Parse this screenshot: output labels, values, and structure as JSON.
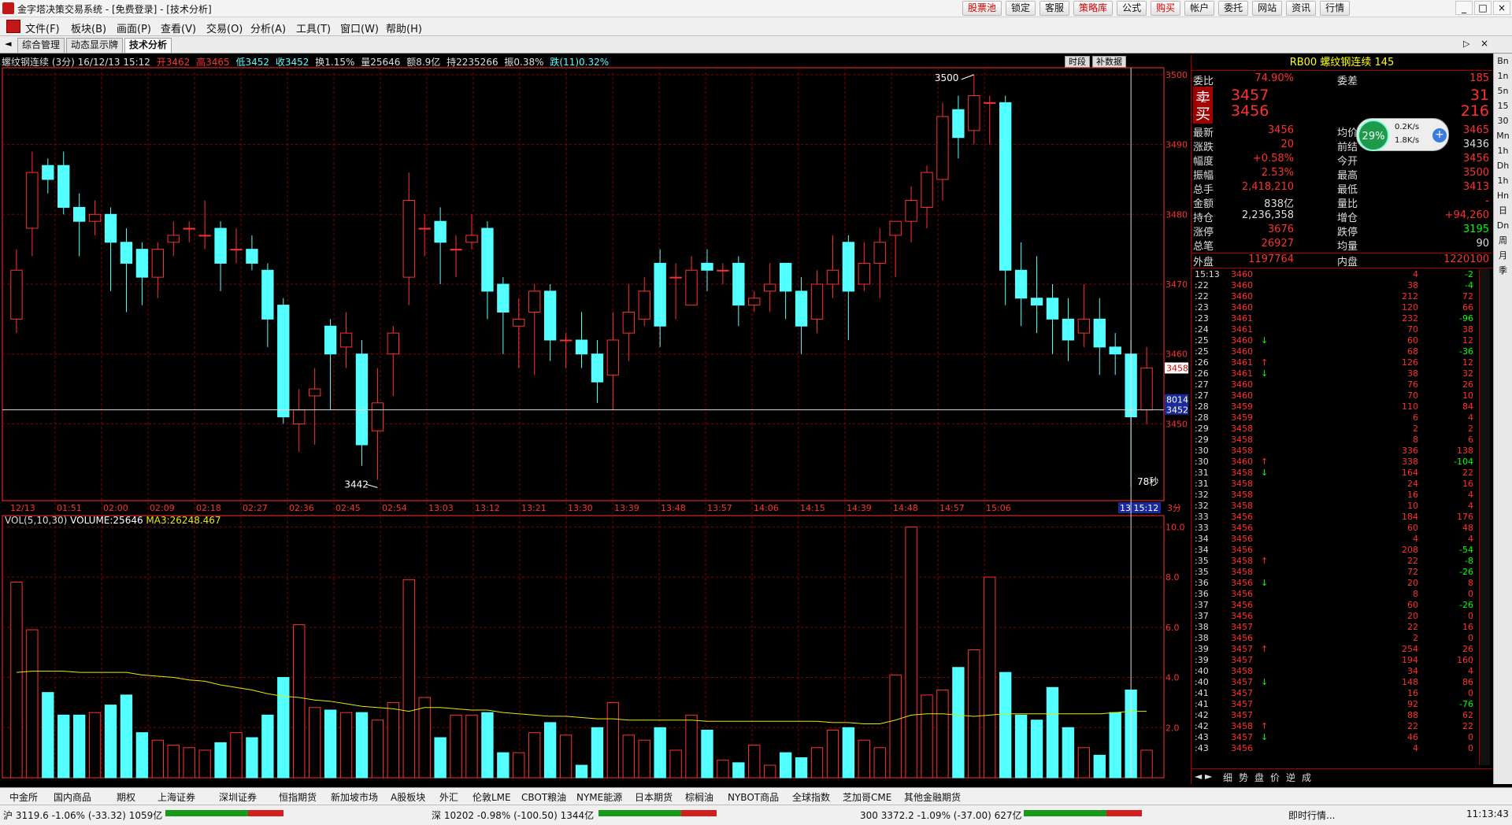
{
  "window": {
    "title": "金字塔决策交易系统 - [免费登录] - [技术分析]",
    "top_buttons": [
      "股票池",
      "锁定",
      "客服",
      "策略库",
      "公式",
      "购买",
      "帐户",
      "委托",
      "网站",
      "资讯",
      "行情"
    ],
    "controls": [
      "_",
      "□",
      "×"
    ]
  },
  "menu": [
    "文件(F)",
    "板块(B)",
    "画面(P)",
    "查看(V)",
    "交易(O)",
    "分析(A)",
    "工具(T)",
    "窗口(W)",
    "帮助(H)"
  ],
  "tabs": [
    "综合管理",
    "动态显示牌",
    "技术分析"
  ],
  "chart_header": {
    "name": "螺纹钢连续 (3分) 16/12/13 15:12",
    "open": "开3462",
    "high": "高3465",
    "low": "低3452",
    "close": "收3452",
    "turnover": "换1.15%",
    "volume": "量25646",
    "amount": "额8.9亿",
    "holding": "持2235266",
    "amplitude": "振0.38%",
    "change": "跌(11)0.32%"
  },
  "chart_buttons": [
    "时段",
    "补数据"
  ],
  "vol_header": {
    "label": "VOL(5,10,30)",
    "volume": "VOLUME:25646",
    "ma3": "MA3:26248.467"
  },
  "colors": {
    "up": "#ff3030",
    "down": "#54ffff",
    "ma": "#e8e800",
    "grid": "#880000",
    "axis": "#ff3030"
  },
  "chart_data": {
    "type": "candlestick",
    "title": "螺纹钢连续 (3分)",
    "time_labels": [
      "12/13",
      "01:51",
      "02:00",
      "02:09",
      "02:18",
      "02:27",
      "02:36",
      "02:45",
      "02:54",
      "13:03",
      "13:12",
      "13:21",
      "13:30",
      "13:39",
      "13:48",
      "13:57",
      "14:06",
      "14:15",
      "14:39",
      "14:48",
      "14:57",
      "15:06",
      "13 15:12"
    ],
    "price_ticks": [
      "3500",
      "3490",
      "3480",
      "3470",
      "3460",
      "3450"
    ],
    "price_range": [
      3439,
      3501
    ],
    "high_label": "3500",
    "low_label": "3442",
    "current_price_label": "3458",
    "current_price_label2": "3452",
    "current_tag": "8014",
    "countdown": "78秒",
    "period_label": "3分",
    "candles": [
      [
        3465,
        3472,
        3463,
        3475
      ],
      [
        3478,
        3486,
        3474,
        3489
      ],
      [
        3487,
        3485,
        3483,
        3488
      ],
      [
        3487,
        3481,
        3480,
        3489
      ],
      [
        3481,
        3479,
        3474,
        3483
      ],
      [
        3479,
        3480,
        3477,
        3482
      ],
      [
        3480,
        3476,
        3469,
        3481
      ],
      [
        3476,
        3473,
        3466,
        3478
      ],
      [
        3475,
        3471,
        3467,
        3476
      ],
      [
        3471,
        3475,
        3468,
        3476
      ],
      [
        3476,
        3477,
        3474,
        3479
      ],
      [
        3478,
        3478,
        3476,
        3479
      ],
      [
        3477,
        3477,
        3475,
        3482
      ],
      [
        3478,
        3473,
        3469,
        3479
      ],
      [
        3475,
        3475,
        3473,
        3478
      ],
      [
        3475,
        3473,
        3472,
        3477
      ],
      [
        3472,
        3465,
        3461,
        3473
      ],
      [
        3467,
        3451,
        3450,
        3468
      ],
      [
        3450,
        3452,
        3446,
        3455
      ],
      [
        3454,
        3455,
        3447,
        3458
      ],
      [
        3464,
        3460,
        3452,
        3465
      ],
      [
        3461,
        3463,
        3458,
        3466
      ],
      [
        3460,
        3447,
        3444,
        3462
      ],
      [
        3449,
        3453,
        3442,
        3458
      ],
      [
        3460,
        3463,
        3454,
        3464
      ],
      [
        3471,
        3482,
        3467,
        3486
      ],
      [
        3478,
        3478,
        3474,
        3480
      ],
      [
        3479,
        3476,
        3470,
        3481
      ],
      [
        3475,
        3475,
        3471,
        3477
      ],
      [
        3476,
        3477,
        3475,
        3480
      ],
      [
        3478,
        3469,
        3465,
        3479
      ],
      [
        3470,
        3466,
        3460,
        3471
      ],
      [
        3464,
        3465,
        3458,
        3468
      ],
      [
        3466,
        3469,
        3457,
        3470
      ],
      [
        3469,
        3462,
        3459,
        3470
      ],
      [
        3462,
        3462,
        3458,
        3463
      ],
      [
        3462,
        3460,
        3458,
        3466
      ],
      [
        3460,
        3456,
        3453,
        3462
      ],
      [
        3457,
        3462,
        3452,
        3466
      ],
      [
        3463,
        3466,
        3459,
        3470
      ],
      [
        3465,
        3469,
        3464,
        3471
      ],
      [
        3473,
        3464,
        3461,
        3475
      ],
      [
        3471,
        3471,
        3465,
        3473
      ],
      [
        3467,
        3472,
        3467,
        3474
      ],
      [
        3473,
        3472,
        3469,
        3475
      ],
      [
        3472,
        3472,
        3470,
        3473
      ],
      [
        3473,
        3467,
        3464,
        3474
      ],
      [
        3467,
        3468,
        3466,
        3469
      ],
      [
        3469,
        3470,
        3466,
        3473
      ],
      [
        3473,
        3469,
        3465,
        3473
      ],
      [
        3469,
        3464,
        3460,
        3471
      ],
      [
        3465,
        3470,
        3463,
        3472
      ],
      [
        3470,
        3472,
        3468,
        3477
      ],
      [
        3476,
        3469,
        3462,
        3477
      ],
      [
        3470,
        3473,
        3469,
        3476
      ],
      [
        3473,
        3476,
        3468,
        3478
      ],
      [
        3477,
        3479,
        3471,
        3479
      ],
      [
        3479,
        3482,
        3476,
        3484
      ],
      [
        3481,
        3486,
        3478,
        3487
      ],
      [
        3485,
        3494,
        3482,
        3496
      ],
      [
        3495,
        3491,
        3488,
        3497
      ],
      [
        3492,
        3497,
        3490,
        3500
      ],
      [
        3496,
        3496,
        3490,
        3497
      ],
      [
        3496,
        3472,
        3467,
        3497
      ],
      [
        3472,
        3468,
        3464,
        3476
      ],
      [
        3468,
        3467,
        3463,
        3474
      ],
      [
        3468,
        3465,
        3460,
        3470
      ],
      [
        3465,
        3462,
        3459,
        3468
      ],
      [
        3463,
        3465,
        3461,
        3470
      ],
      [
        3465,
        3461,
        3457,
        3468
      ],
      [
        3461,
        3460,
        3457,
        3463
      ],
      [
        3460,
        3451,
        3441,
        3462
      ],
      [
        3452,
        3458,
        3450,
        3461
      ]
    ],
    "volumes": [
      7.8,
      5.9,
      3.4,
      2.5,
      2.5,
      2.6,
      2.9,
      3.3,
      1.8,
      1.5,
      1.3,
      1.2,
      1.1,
      1.4,
      1.8,
      1.6,
      2.5,
      4.0,
      6.1,
      2.8,
      2.7,
      2.6,
      2.6,
      2.3,
      3.0,
      7.9,
      3.2,
      1.6,
      2.5,
      2.5,
      2.6,
      1.0,
      1.0,
      1.8,
      2.2,
      1.7,
      0.5,
      2.0,
      3.0,
      1.7,
      1.5,
      2.0,
      1.1,
      2.5,
      1.9,
      0.7,
      0.6,
      1.3,
      0.5,
      1.0,
      0.8,
      1.2,
      1.9,
      2.0,
      1.5,
      1.2,
      4.1,
      10.0,
      3.3,
      3.5,
      4.4,
      5.1,
      8.0,
      4.2,
      2.5,
      2.3,
      3.6,
      2.0,
      1.2,
      0.9,
      2.6,
      3.5,
      1.1
    ],
    "ma_values": [
      4.2,
      4.25,
      4.25,
      4.25,
      4.2,
      4.2,
      4.2,
      4.2,
      4.1,
      4.05,
      4.0,
      3.9,
      3.85,
      3.7,
      3.6,
      3.5,
      3.35,
      3.25,
      3.2,
      3.1,
      3.05,
      2.95,
      2.85,
      2.8,
      2.75,
      2.65,
      2.8,
      2.8,
      2.75,
      2.7,
      2.7,
      2.6,
      2.55,
      2.5,
      2.45,
      2.45,
      2.4,
      2.35,
      2.35,
      2.3,
      2.3,
      2.3,
      2.3,
      2.3,
      2.25,
      2.25,
      2.25,
      2.25,
      2.25,
      2.25,
      2.25,
      2.25,
      2.2,
      2.2,
      2.15,
      2.15,
      2.3,
      2.5,
      2.55,
      2.55,
      2.5,
      2.45,
      2.5,
      2.55,
      2.55,
      2.55,
      2.55,
      2.55,
      2.55,
      2.55,
      2.6,
      2.65,
      2.65
    ],
    "vol_ticks": [
      "10.0",
      "8.0",
      "6.0",
      "4.0",
      "2.0"
    ],
    "vol_range": [
      0,
      10.2
    ],
    "legend": "VOL(5,10,30)"
  },
  "quote_panel": {
    "header": "RB00  螺纹钢连续  145",
    "rows": [
      {
        "l": "委比",
        "v1": "74.90%",
        "l2": "委差",
        "v2": "185"
      },
      {
        "l": "卖",
        "v1": "3457",
        "l2": "",
        "v2": "31"
      },
      {
        "l": "买",
        "v1": "3456",
        "l2": "",
        "v2": "216"
      },
      {
        "l": "最新",
        "v1": "3456",
        "l2": "均价",
        "v2": "3465"
      },
      {
        "l": "涨跌",
        "v1": "20",
        "l2": "前结",
        "v2": "3436"
      },
      {
        "l": "幅度",
        "v1": "+0.58%",
        "l2": "今开",
        "v2": "3456"
      },
      {
        "l": "振幅",
        "v1": "2.53%",
        "l2": "最高",
        "v2": "3500"
      },
      {
        "l": "总手",
        "v1": "2,418,210",
        "l2": "最低",
        "v2": "3413"
      },
      {
        "l": "金额",
        "v1": "838亿",
        "l2": "量比",
        "v2": "-"
      },
      {
        "l": "持仓",
        "v1": "2,236,358",
        "l2": "增仓",
        "v2": "+94,260"
      },
      {
        "l": "涨停",
        "v1": "3676",
        "l2": "跌停",
        "v2": "3195"
      },
      {
        "l": "总笔",
        "v1": "26927",
        "l2": "均量",
        "v2": "90"
      },
      {
        "l": "外盘",
        "v1": "1197764",
        "l2": "内盘",
        "v2": "1220100"
      }
    ],
    "badge": {
      "percent": "29%",
      "up": "0.2K/s",
      "down": "1.8K/s"
    },
    "ticks": [
      [
        "15:13",
        "3460",
        "4",
        "-2",
        ""
      ],
      [
        ":22",
        "3460",
        "38",
        "-4",
        ""
      ],
      [
        ":22",
        "3460",
        "212",
        "72",
        ""
      ],
      [
        ":23",
        "3460",
        "120",
        "66",
        ""
      ],
      [
        ":23",
        "3461",
        "232",
        "-96",
        ""
      ],
      [
        ":24",
        "3461",
        "70",
        "38",
        ""
      ],
      [
        ":25",
        "3460",
        "60",
        "12",
        "↓"
      ],
      [
        ":25",
        "3460",
        "68",
        "-36",
        ""
      ],
      [
        ":26",
        "3461",
        "126",
        "12",
        "↑"
      ],
      [
        ":26",
        "3461",
        "38",
        "32",
        "↓"
      ],
      [
        ":27",
        "3460",
        "76",
        "26",
        ""
      ],
      [
        ":27",
        "3460",
        "70",
        "10",
        ""
      ],
      [
        ":28",
        "3459",
        "110",
        "84",
        ""
      ],
      [
        ":28",
        "3459",
        "6",
        "4",
        ""
      ],
      [
        ":29",
        "3458",
        "2",
        "2",
        ""
      ],
      [
        ":29",
        "3458",
        "8",
        "6",
        ""
      ],
      [
        ":30",
        "3458",
        "336",
        "138",
        ""
      ],
      [
        ":30",
        "3460",
        "338",
        "-104",
        "↑"
      ],
      [
        ":31",
        "3458",
        "164",
        "22",
        "↓"
      ],
      [
        ":31",
        "3458",
        "24",
        "16",
        ""
      ],
      [
        ":32",
        "3458",
        "16",
        "4",
        ""
      ],
      [
        ":32",
        "3458",
        "10",
        "4",
        ""
      ],
      [
        ":33",
        "3456",
        "184",
        "176",
        ""
      ],
      [
        ":33",
        "3456",
        "60",
        "48",
        ""
      ],
      [
        ":34",
        "3456",
        "4",
        "4",
        ""
      ],
      [
        ":34",
        "3456",
        "208",
        "-54",
        ""
      ],
      [
        ":35",
        "3458",
        "22",
        "-8",
        "↑"
      ],
      [
        ":35",
        "3458",
        "72",
        "-26",
        ""
      ],
      [
        ":36",
        "3456",
        "20",
        "8",
        "↓"
      ],
      [
        ":36",
        "3456",
        "8",
        "0",
        ""
      ],
      [
        ":37",
        "3456",
        "60",
        "-26",
        ""
      ],
      [
        ":37",
        "3456",
        "20",
        "0",
        ""
      ],
      [
        ":38",
        "3457",
        "22",
        "16",
        ""
      ],
      [
        ":38",
        "3456",
        "2",
        "0",
        ""
      ],
      [
        ":39",
        "3457",
        "254",
        "26",
        "↑"
      ],
      [
        ":39",
        "3457",
        "194",
        "160",
        ""
      ],
      [
        ":40",
        "3458",
        "34",
        "4",
        ""
      ],
      [
        ":40",
        "3457",
        "148",
        "86",
        "↓"
      ],
      [
        ":41",
        "3457",
        "16",
        "0",
        ""
      ],
      [
        ":41",
        "3457",
        "92",
        "-76",
        ""
      ],
      [
        ":42",
        "3457",
        "88",
        "62",
        ""
      ],
      [
        ":42",
        "3458",
        "22",
        "22",
        "↑"
      ],
      [
        ":43",
        "3457",
        "46",
        "0",
        "↓"
      ],
      [
        ":43",
        "3456",
        "4",
        "0",
        ""
      ]
    ],
    "footer": [
      "细",
      "势",
      "盘",
      "价",
      "逆",
      "成"
    ]
  },
  "sidebar": [
    "Bn",
    "1n",
    "5n",
    "15",
    "30",
    "Mn",
    "1h",
    "Dh",
    "1h",
    "Hn",
    "日",
    "Dn",
    "周",
    "月",
    "季"
  ],
  "bottom_tabs": [
    "中金所",
    "国内商品",
    "期权",
    "上海证券",
    "深圳证券",
    "恒指期货",
    "新加坡市场",
    "A股板块",
    "外汇",
    "伦敦LME",
    "CBOT粮油",
    "NYME能源",
    "日本期货",
    "棕榈油",
    "NYBOT商品",
    "全球指数",
    "芝加哥CME",
    "其他金融期货"
  ],
  "status": {
    "sh": "沪 3119.6 -1.06% (-33.32) 1059亿",
    "sz": "深 10202 -0.98% (-100.50) 1344亿",
    "s300": "300 3372.2 -1.09% (-37.00) 627亿",
    "notice": "即时行情...",
    "time": "11:13:43"
  }
}
